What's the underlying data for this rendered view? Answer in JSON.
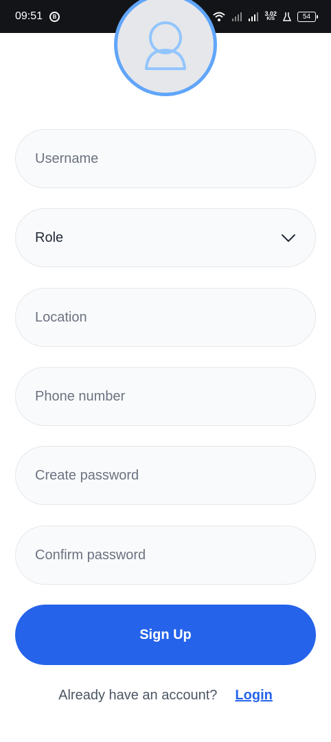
{
  "statusbar": {
    "time": "09:51",
    "notif": "B",
    "net_speed": "3.02",
    "net_unit": "K/S",
    "battery": "54"
  },
  "form": {
    "username_placeholder": "Username",
    "role_value": "Role",
    "location_placeholder": "Location",
    "phone_placeholder": "Phone number",
    "password_placeholder": "Create password",
    "confirm_placeholder": "Confirm password",
    "submit_label": "Sign Up"
  },
  "footer": {
    "question": "Already have an account?",
    "login_label": "Login"
  },
  "colors": {
    "primary": "#2563eb",
    "avatar_ring": "#60a5fa",
    "status_bar": "#121417"
  }
}
